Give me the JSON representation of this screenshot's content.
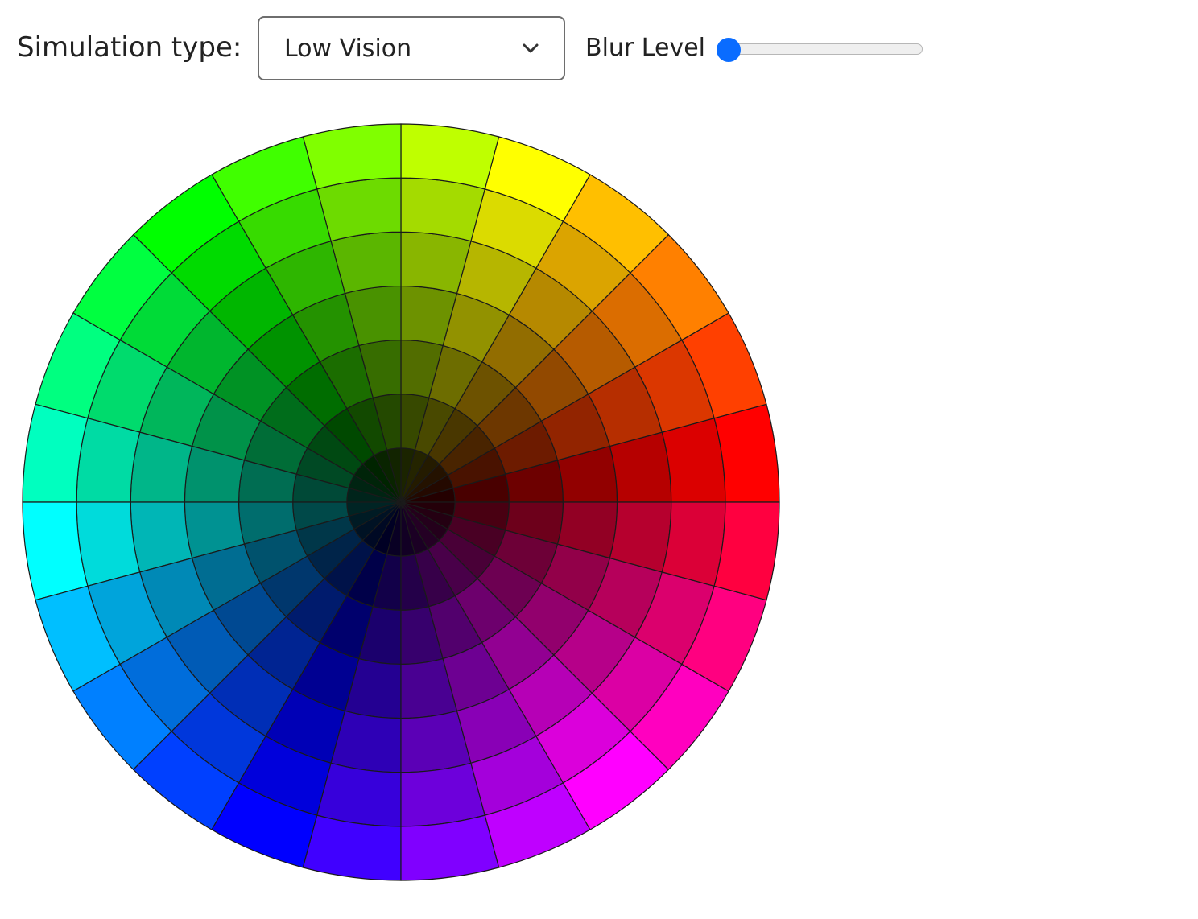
{
  "toolbar": {
    "simulation_label": "Simulation type:",
    "simulation_select": {
      "value": "Low Vision"
    },
    "blur": {
      "label": "Blur Level",
      "value_fraction": 0.0
    }
  },
  "color_wheel": {
    "segments": 24,
    "rings": 7,
    "hue_at_right": 0,
    "hue_direction": "clockwise-from-right-is-counterclockwise-hue"
  },
  "colors": {
    "accent": "#0a6cff",
    "border": "#6e6e6e",
    "grid_line": "#1a1a1a"
  },
  "icons": {
    "dropdown": "chevron-down-icon"
  }
}
